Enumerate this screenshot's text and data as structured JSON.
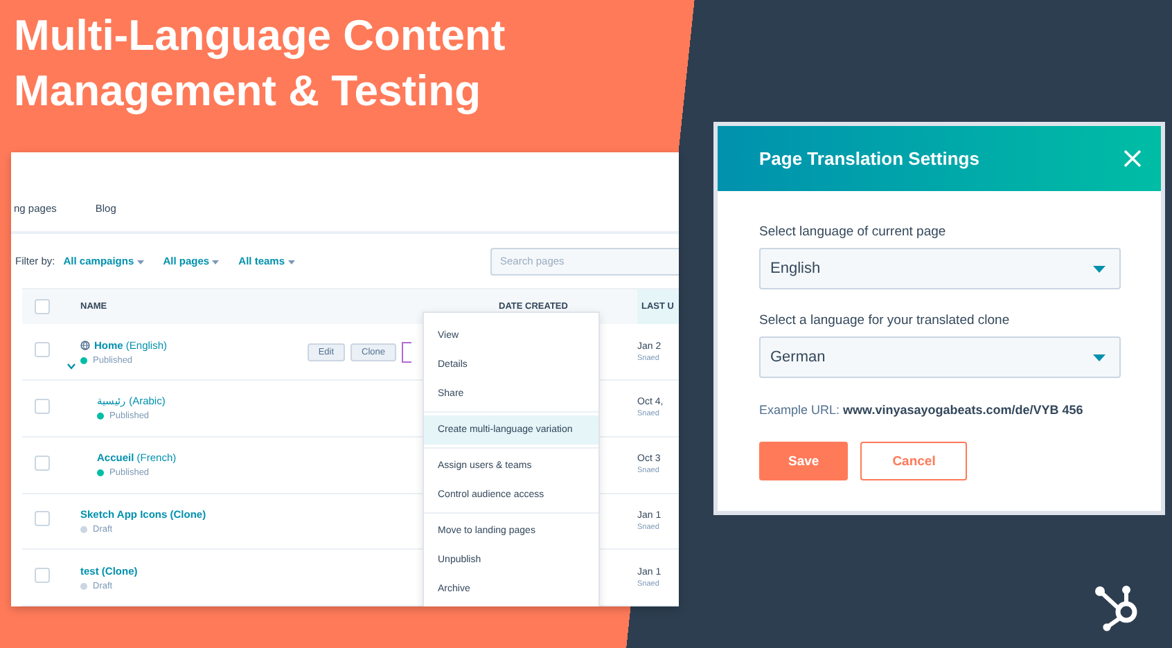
{
  "headline_lines": [
    "Multi-Language Content",
    "Management & Testing"
  ],
  "pages_screen": {
    "nav_tabs": [
      "ng pages",
      "Blog"
    ],
    "filter": {
      "label": "Filter by:",
      "dropdowns": [
        "All campaigns",
        "All pages",
        "All teams"
      ],
      "search": {
        "placeholder": "Search pages"
      }
    },
    "select_all_checked": false,
    "columns": [
      {
        "label": "NAME",
        "sorted": false
      },
      {
        "label": "DATE CREATED",
        "sorted": false
      },
      {
        "label": "LAST U",
        "sorted": true
      }
    ],
    "rows": [
      {
        "title": "**Home** (English)",
        "status": "Published",
        "color": "#00bda5",
        "checked": false,
        "expanded": true,
        "actions": [
          "Edit",
          "Clone"
        ],
        "last_updated": "Jan 2",
        "author": "Snaed",
        "children": [
          {
            "title": "رئيسية (Arabic)",
            "status": "Published",
            "color": "#00bda5",
            "checked": false,
            "last_updated": "Oct 4,",
            "author": "Snaed"
          },
          {
            "title": "**Accueil** (French)",
            "status": "Published",
            "color": "#00bda5",
            "checked": false,
            "last_updated": "Oct 3",
            "author": "Snaed"
          }
        ]
      },
      {
        "title": "**Sketch App Icons (Clone)**",
        "status": "Draft",
        "color": "#cbd6e2",
        "checked": false,
        "last_updated": "Jan 1",
        "author": "Snaed"
      },
      {
        "title": "**test (Clone)**",
        "status": "Draft",
        "color": "#cbd6e2",
        "checked": false,
        "last_updated": "Jan 1",
        "author": "Snaed"
      }
    ],
    "menu_groups": [
      [
        {
          "label": "View",
          "selected": false
        },
        {
          "label": "Details",
          "selected": false
        },
        {
          "label": "Share",
          "selected": false
        }
      ],
      [
        {
          "label": "Create multi-language variation",
          "selected": true
        }
      ],
      [
        {
          "label": "Assign users & teams",
          "selected": false
        },
        {
          "label": "Control audience access",
          "selected": false
        }
      ],
      [
        {
          "label": "Move to landing pages",
          "selected": false
        },
        {
          "label": "Unpublish",
          "selected": false
        },
        {
          "label": "Archive",
          "selected": false
        }
      ]
    ]
  },
  "dialog": {
    "title": "Page Translation Settings",
    "fields": [
      {
        "label": "Select language of current page",
        "value": "English"
      },
      {
        "label": "Select a language for your translated clone",
        "value": "German"
      }
    ],
    "example": "Example URL: **www.vinyasayogabeats.com/de/VYB 456**",
    "buttons": [
      {
        "label": "Save",
        "kind": "primary"
      },
      {
        "label": "Cancel",
        "kind": "secondary"
      }
    ]
  }
}
